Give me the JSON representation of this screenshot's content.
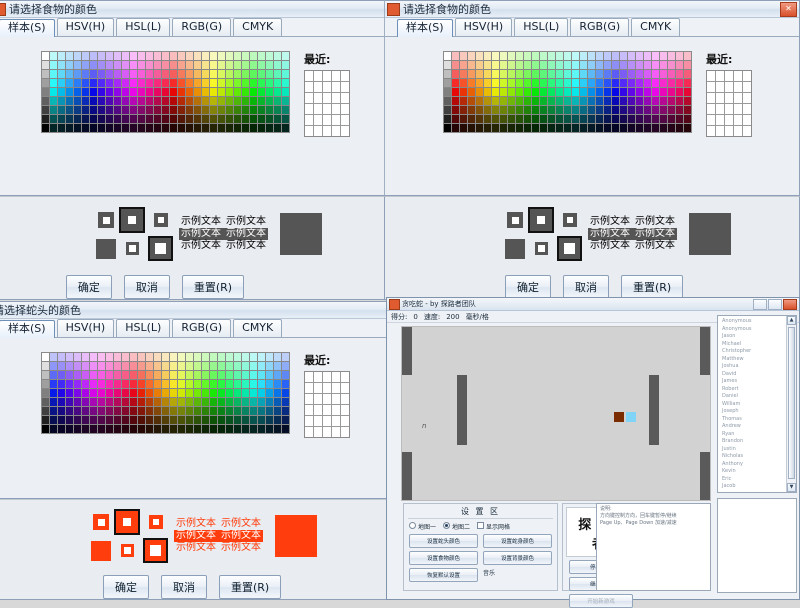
{
  "colors": {
    "accent": "#3c6ea5",
    "orange": "#ff3d0d",
    "dark_gray": "#555555",
    "window_bg": "#eceff3",
    "titlebar_top": "#f2f6fb",
    "playfield_bg": "#d2d2d2",
    "wall": "#5a5a5a",
    "food": "#7a2b00",
    "snake": "#7fd4f7"
  },
  "dialog_food_1": {
    "title": "请选择食物的颜色",
    "tabs": [
      "样本(S)",
      "HSV(H)",
      "HSL(L)",
      "RGB(G)",
      "CMYK"
    ],
    "active_tab": "样本(S)",
    "recent_label": "最近:",
    "preview_texts": [
      "示例文本",
      "示例文本",
      "示例文本",
      "示例文本",
      "示例文本",
      "示例文本"
    ],
    "buttons": [
      "确定",
      "取消",
      "重置(R)"
    ],
    "selected_color": "#555555",
    "window_buttons": [
      "–",
      "□",
      "✕"
    ]
  },
  "dialog_food_2": {
    "title": "请选择食物的颜色",
    "tabs": [
      "样本(S)",
      "HSV(H)",
      "HSL(L)",
      "RGB(G)",
      "CMYK"
    ],
    "active_tab": "样本(S)",
    "recent_label": "最近:",
    "preview_texts": [
      "示例文本",
      "示例文本",
      "示例文本",
      "示例文本",
      "示例文本",
      "示例文本"
    ],
    "buttons": [
      "确定",
      "取消",
      "重置(R)"
    ],
    "selected_color": "#555555",
    "window_buttons": [
      "–",
      "□",
      "✕"
    ]
  },
  "dialog_head": {
    "title": "请选择蛇头的颜色",
    "tabs": [
      "样本(S)",
      "HSV(H)",
      "HSL(L)",
      "RGB(G)",
      "CMYK"
    ],
    "active_tab": "样本(S)",
    "recent_label": "最近:",
    "preview_texts": [
      "示例文本",
      "示例文本",
      "示例文本",
      "示例文本",
      "示例文本",
      "示例文本"
    ],
    "buttons": [
      "确定",
      "取消",
      "重置(R)"
    ],
    "selected_color": "#ff3d0d",
    "window_buttons": [
      "–",
      "□",
      "✕"
    ]
  },
  "game": {
    "title": "贪吃蛇 - by 探路者团队",
    "status": {
      "score_label": "得分:",
      "score_value": "0",
      "speed_label": "速度:",
      "speed_value": "200",
      "speed_unit": "毫秒/格"
    },
    "settings_panel": {
      "title": "设 置 区",
      "radios": [
        {
          "label": "地图一",
          "selected": false
        },
        {
          "label": "地图二",
          "selected": true
        }
      ],
      "checkbox": {
        "label": "显示网格",
        "checked": false
      },
      "buttons": [
        "设置蛇头颜色",
        "设置蛇身颜色",
        "设置食物颜色",
        "设置背景颜色",
        "恢复默认设置"
      ],
      "music_label": "音乐"
    },
    "brand": "探 路 者",
    "side_buttons": [
      {
        "label": "停止游戏",
        "enabled": true
      },
      {
        "label": "继续模式",
        "enabled": true
      },
      {
        "label": "开始新游戏",
        "enabled": false
      }
    ],
    "info_panel": {
      "heading": "说明:",
      "lines": [
        "方向键控制方向，回车键暂停/继续",
        "Page Up、Page Down 加速/减速"
      ]
    },
    "rank_list": [
      "Anonymous",
      "Anonymous",
      "Jason",
      "Michael",
      "Christopher",
      "Matthew",
      "Joshua",
      "David",
      "James",
      "Robert",
      "Daniel",
      "William",
      "Joseph",
      "Thomas",
      "Andrew",
      "Ryan",
      "Brandon",
      "Justin",
      "Nicholas",
      "Anthony",
      "Kevin",
      "Eric",
      "Jacob"
    ],
    "window_buttons": [
      "–",
      "□",
      "✕"
    ]
  }
}
